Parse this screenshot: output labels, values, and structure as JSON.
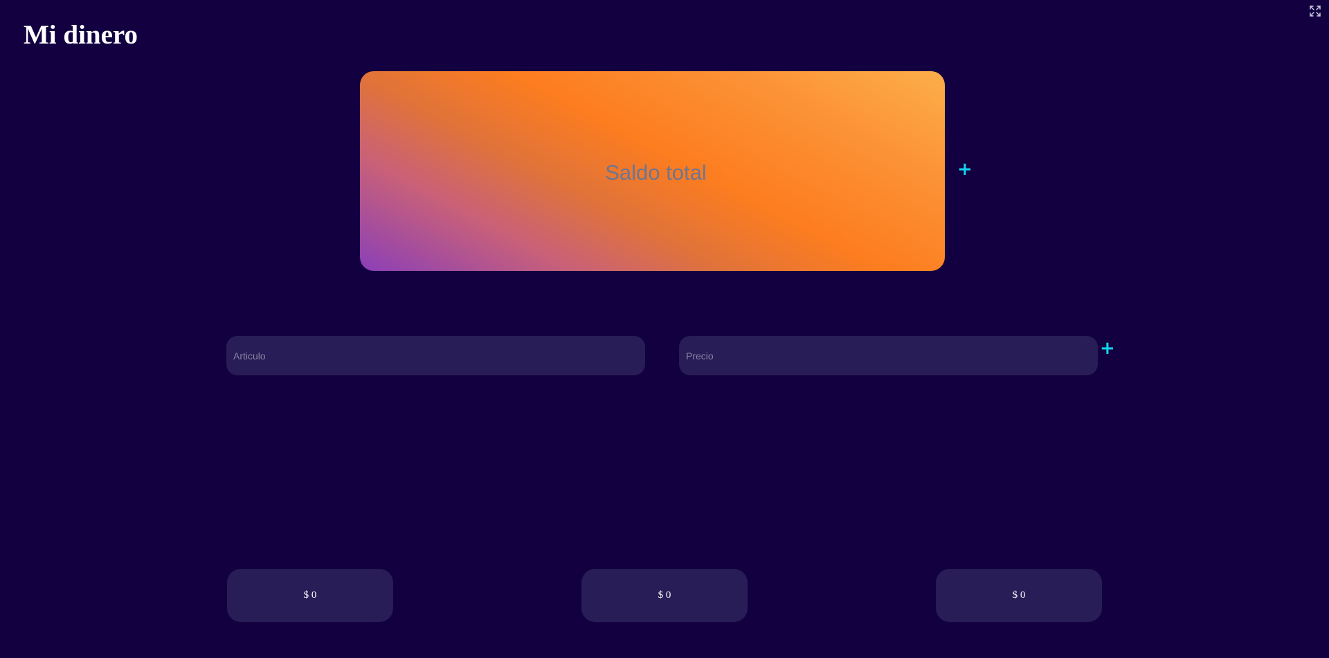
{
  "header": {
    "title": "Mi dinero"
  },
  "balance_card": {
    "label": "Saldo total",
    "add_icon": "plus-icon"
  },
  "form": {
    "article_placeholder": "Articulo",
    "article_value": "",
    "price_placeholder": "Precio",
    "price_value": "",
    "add_icon": "plus-icon"
  },
  "summary": {
    "boxes": [
      {
        "value": "$ 0"
      },
      {
        "value": "$ 0"
      },
      {
        "value": "$ 0"
      }
    ]
  },
  "colors": {
    "background": "#130040",
    "accent": "#12d6ee",
    "field_background": "#281d56",
    "card_gradient": [
      "#8a3fb8",
      "#fd7d1f",
      "#fcae4a"
    ]
  },
  "icons": {
    "fullscreen": "fullscreen-expand-icon"
  }
}
